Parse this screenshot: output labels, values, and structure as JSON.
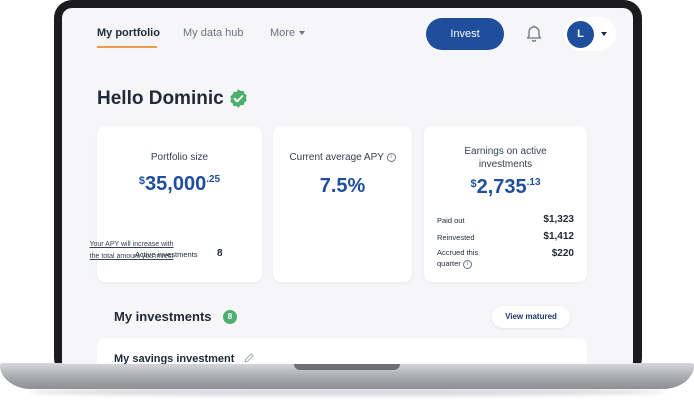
{
  "nav": {
    "tabs": [
      {
        "label": "My portfolio",
        "active": true
      },
      {
        "label": "My data hub",
        "active": false
      },
      {
        "label": "More",
        "active": false,
        "dropdown": true
      }
    ],
    "invest_label": "Invest",
    "notification_icon": "bell-icon",
    "avatar_initial": "L",
    "accent": "#1f4e9d",
    "tab_underline_color": "#f2994a"
  },
  "greeting": {
    "text": "Hello Dominic",
    "badge_icon": "verified-check-icon",
    "badge_color": "#4caf6e"
  },
  "portfolio": {
    "title": "Portfolio size",
    "currency": "$",
    "amount": "35,000",
    "cents": ".25",
    "active_label": "Active investments",
    "active_count": "8"
  },
  "apy": {
    "title": "Current average APY",
    "value": "7.5%",
    "note_line1": "Your APY will increase with",
    "note_line2": "the total amount you invest"
  },
  "earnings": {
    "title_line1": "Earnings on active",
    "title_line2": "investments",
    "currency": "$",
    "amount": "2,735",
    "cents": ".13",
    "rows": [
      {
        "label": "Paid out",
        "value": "$1,323"
      },
      {
        "label": "Reinvested",
        "value": "$1,412"
      },
      {
        "label_line1": "Accrued this",
        "label_line2": "quarter",
        "value": "$220"
      }
    ]
  },
  "investments": {
    "title": "My investments",
    "count": "8",
    "view_matured_label": "View matured",
    "savings_title": "My savings investment"
  }
}
